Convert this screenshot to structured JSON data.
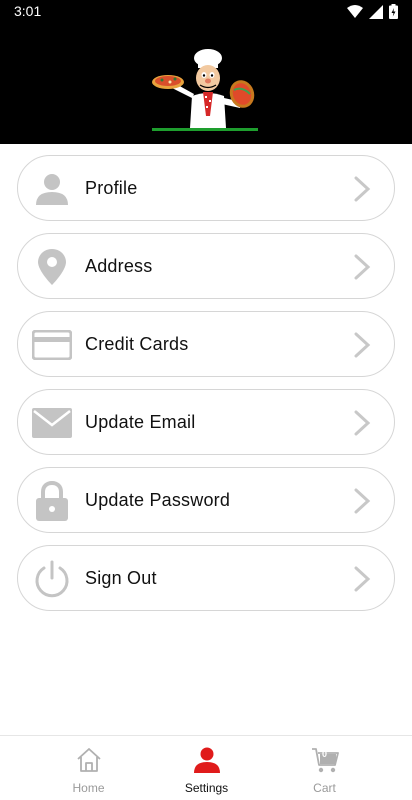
{
  "status_bar": {
    "time": "3:01",
    "icons": [
      "wifi-icon",
      "signal-icon",
      "battery-icon"
    ]
  },
  "header": {
    "logo": "pizza-chef-logo"
  },
  "menu": {
    "items": [
      {
        "label": "Profile",
        "icon": "person-icon"
      },
      {
        "label": "Address",
        "icon": "location-pin-icon"
      },
      {
        "label": "Credit Cards",
        "icon": "credit-card-icon"
      },
      {
        "label": "Update Email",
        "icon": "envelope-icon"
      },
      {
        "label": "Update Password",
        "icon": "lock-icon"
      },
      {
        "label": "Sign Out",
        "icon": "power-icon"
      }
    ]
  },
  "bottom_nav": {
    "tabs": [
      {
        "label": "Home",
        "icon": "home-icon",
        "active": false
      },
      {
        "label": "Settings",
        "icon": "person-icon",
        "active": true
      },
      {
        "label": "Cart",
        "icon": "cart-icon",
        "active": false,
        "count": "0"
      }
    ]
  },
  "colors": {
    "header_bg": "#000000",
    "accent": "#e01b1b",
    "icon_gray": "#c4c4c4",
    "border": "#d6d6d6"
  }
}
